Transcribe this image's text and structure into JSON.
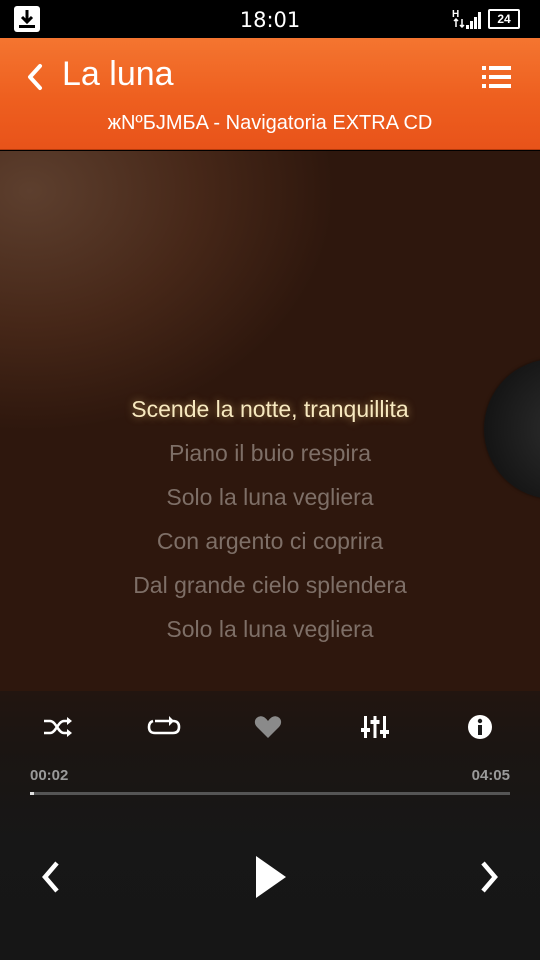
{
  "status_bar": {
    "time": "18:01",
    "battery": "24",
    "network": "H",
    "icons": [
      "download-icon",
      "signal-icon",
      "battery-icon"
    ]
  },
  "header": {
    "title": "La luna",
    "subtitle": "жNºБJMБA - Navigatoria EXTRA CD",
    "back_icon": "chevron-left-icon",
    "menu_icon": "list-icon",
    "accent_color": "#ee5f1f"
  },
  "lyrics": {
    "current_index": 0,
    "lines": [
      "Scende la notte, tranquillita",
      "Piano il buio respira",
      "Solo la luna vegliera",
      "Con argento ci coprira",
      "Dal grande cielo splendera",
      "Solo la luna vegliera"
    ]
  },
  "controls": {
    "icons": [
      "shuffle-icon",
      "repeat-icon",
      "heart-icon",
      "equalizer-icon",
      "info-icon"
    ]
  },
  "progress": {
    "elapsed": "00:02",
    "total": "04:05",
    "fraction": 0.008
  },
  "playback": {
    "icons": [
      "previous-icon",
      "play-icon",
      "next-icon"
    ]
  }
}
